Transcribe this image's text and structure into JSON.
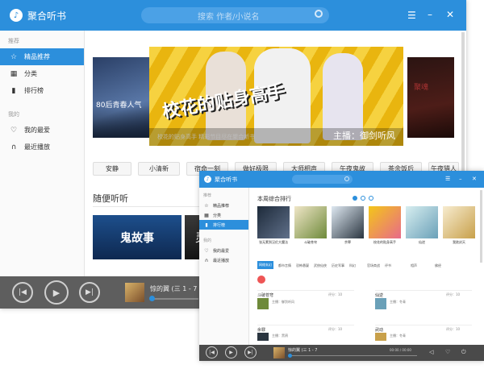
{
  "main_window": {
    "app_title": "聚合听书",
    "search_placeholder": "搜索 作者/小说名",
    "sidebar": {
      "section_recommend": "推荐",
      "items": [
        {
          "label": "精品推荐",
          "icon": "star-icon"
        },
        {
          "label": "分类",
          "icon": "grid-icon"
        },
        {
          "label": "排行榜",
          "icon": "bar-chart-icon"
        }
      ],
      "section_mine": "我的",
      "mine_items": [
        {
          "label": "我的最爱",
          "icon": "heart-icon"
        },
        {
          "label": "最近播放",
          "icon": "headphones-icon"
        }
      ]
    },
    "banner": {
      "left_text": "80后青春人气",
      "center_title": "校花的贴身高手",
      "center_sub": "校花的贴身高手 精彩节目尽在聚合听书",
      "anchor": "主播：御剑听风"
    },
    "tags": [
      "安静",
      "小清新",
      "宿命一刻",
      "做好极限",
      "大师相声",
      "午夜鬼故",
      "茶余饭后",
      "午夜猎人"
    ],
    "section_title": "随便听听",
    "cards": [
      "鬼故事",
      "灵"
    ],
    "player": {
      "track": "惊的翼 (三 1 - 7"
    }
  },
  "second_window": {
    "app_title": "聚合听书",
    "sidebar": {
      "section_recommend": "推荐",
      "items": [
        "精品推荐",
        "分类",
        "排行榜"
      ],
      "section_mine": "我的",
      "mine_items": [
        "我的最爱",
        "最近播放"
      ]
    },
    "chart_title": "本周综合排行",
    "books": [
      "张无素到汉伦大魔法",
      "斗破苍穹",
      "余罪",
      "校花的贴身高手",
      "仙逆",
      "我欲封天"
    ],
    "categories": [
      "网络玄幻",
      "都市言情",
      "恐怖悬疑",
      "武侠仙侠",
      "历史军事",
      "科幻",
      "官场商战",
      "评书",
      "相声",
      "佛经"
    ],
    "list": [
      {
        "title": "斗破苍穹",
        "author": "主播：御剑听风",
        "meta": "评分：10"
      },
      {
        "title": "仙逆",
        "author": "主播：冬青",
        "meta": "评分：10"
      },
      {
        "title": "余罪",
        "author": "主播：黑鸦",
        "meta": "评分：10"
      },
      {
        "title": "武动",
        "author": "主播：冬青",
        "meta": "评分：10"
      }
    ],
    "player": {
      "track": "惊的翼 (三 1 - 7",
      "time": "00:00 / 00:00"
    }
  },
  "colors": {
    "accent": "#2c8fdc",
    "player": "#5e5e5e"
  }
}
